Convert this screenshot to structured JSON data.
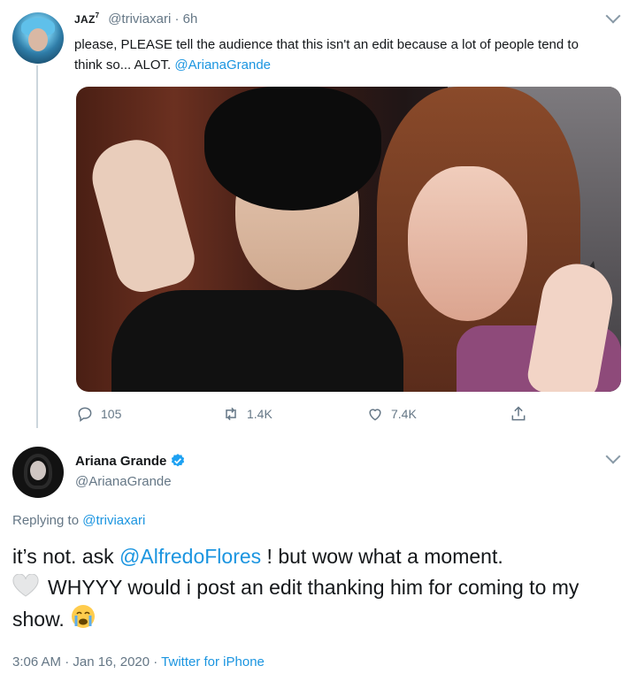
{
  "tweet1": {
    "author_name": "JAZ",
    "author_sup": "7",
    "handle": "@triviaxari",
    "time": "· 6h",
    "text_pre": "please, PLEASE tell the audience that this isn't an edit because a lot of people tend to think so... ALOT. ",
    "mention": "@ArianaGrande",
    "counts": {
      "replies": "105",
      "retweets": "1.4K",
      "likes": "7.4K"
    }
  },
  "tweet2": {
    "author_name": "Ariana Grande",
    "handle": "@ArianaGrande",
    "replying_label": "Replying to ",
    "replying_handle": "@triviaxari",
    "text_1": "it’s not. ask ",
    "mention": "@AlfredoFlores",
    "text_2": " ! but wow what a moment.",
    "text_3": "WHYYY would i post an edit thanking him for coming to my show. ",
    "time": "3:06 AM · Jan 16, 2020 · ",
    "source": "Twitter for iPhone"
  },
  "colors": {
    "link": "#1b95e0",
    "secondary_text": "#657786",
    "verified": "#1da1f2"
  },
  "icons": [
    "reply-icon",
    "retweet-icon",
    "like-icon",
    "share-icon",
    "verified-badge-icon",
    "white-heart-emoji",
    "crying-face-emoji",
    "chevron-down-icon"
  ]
}
